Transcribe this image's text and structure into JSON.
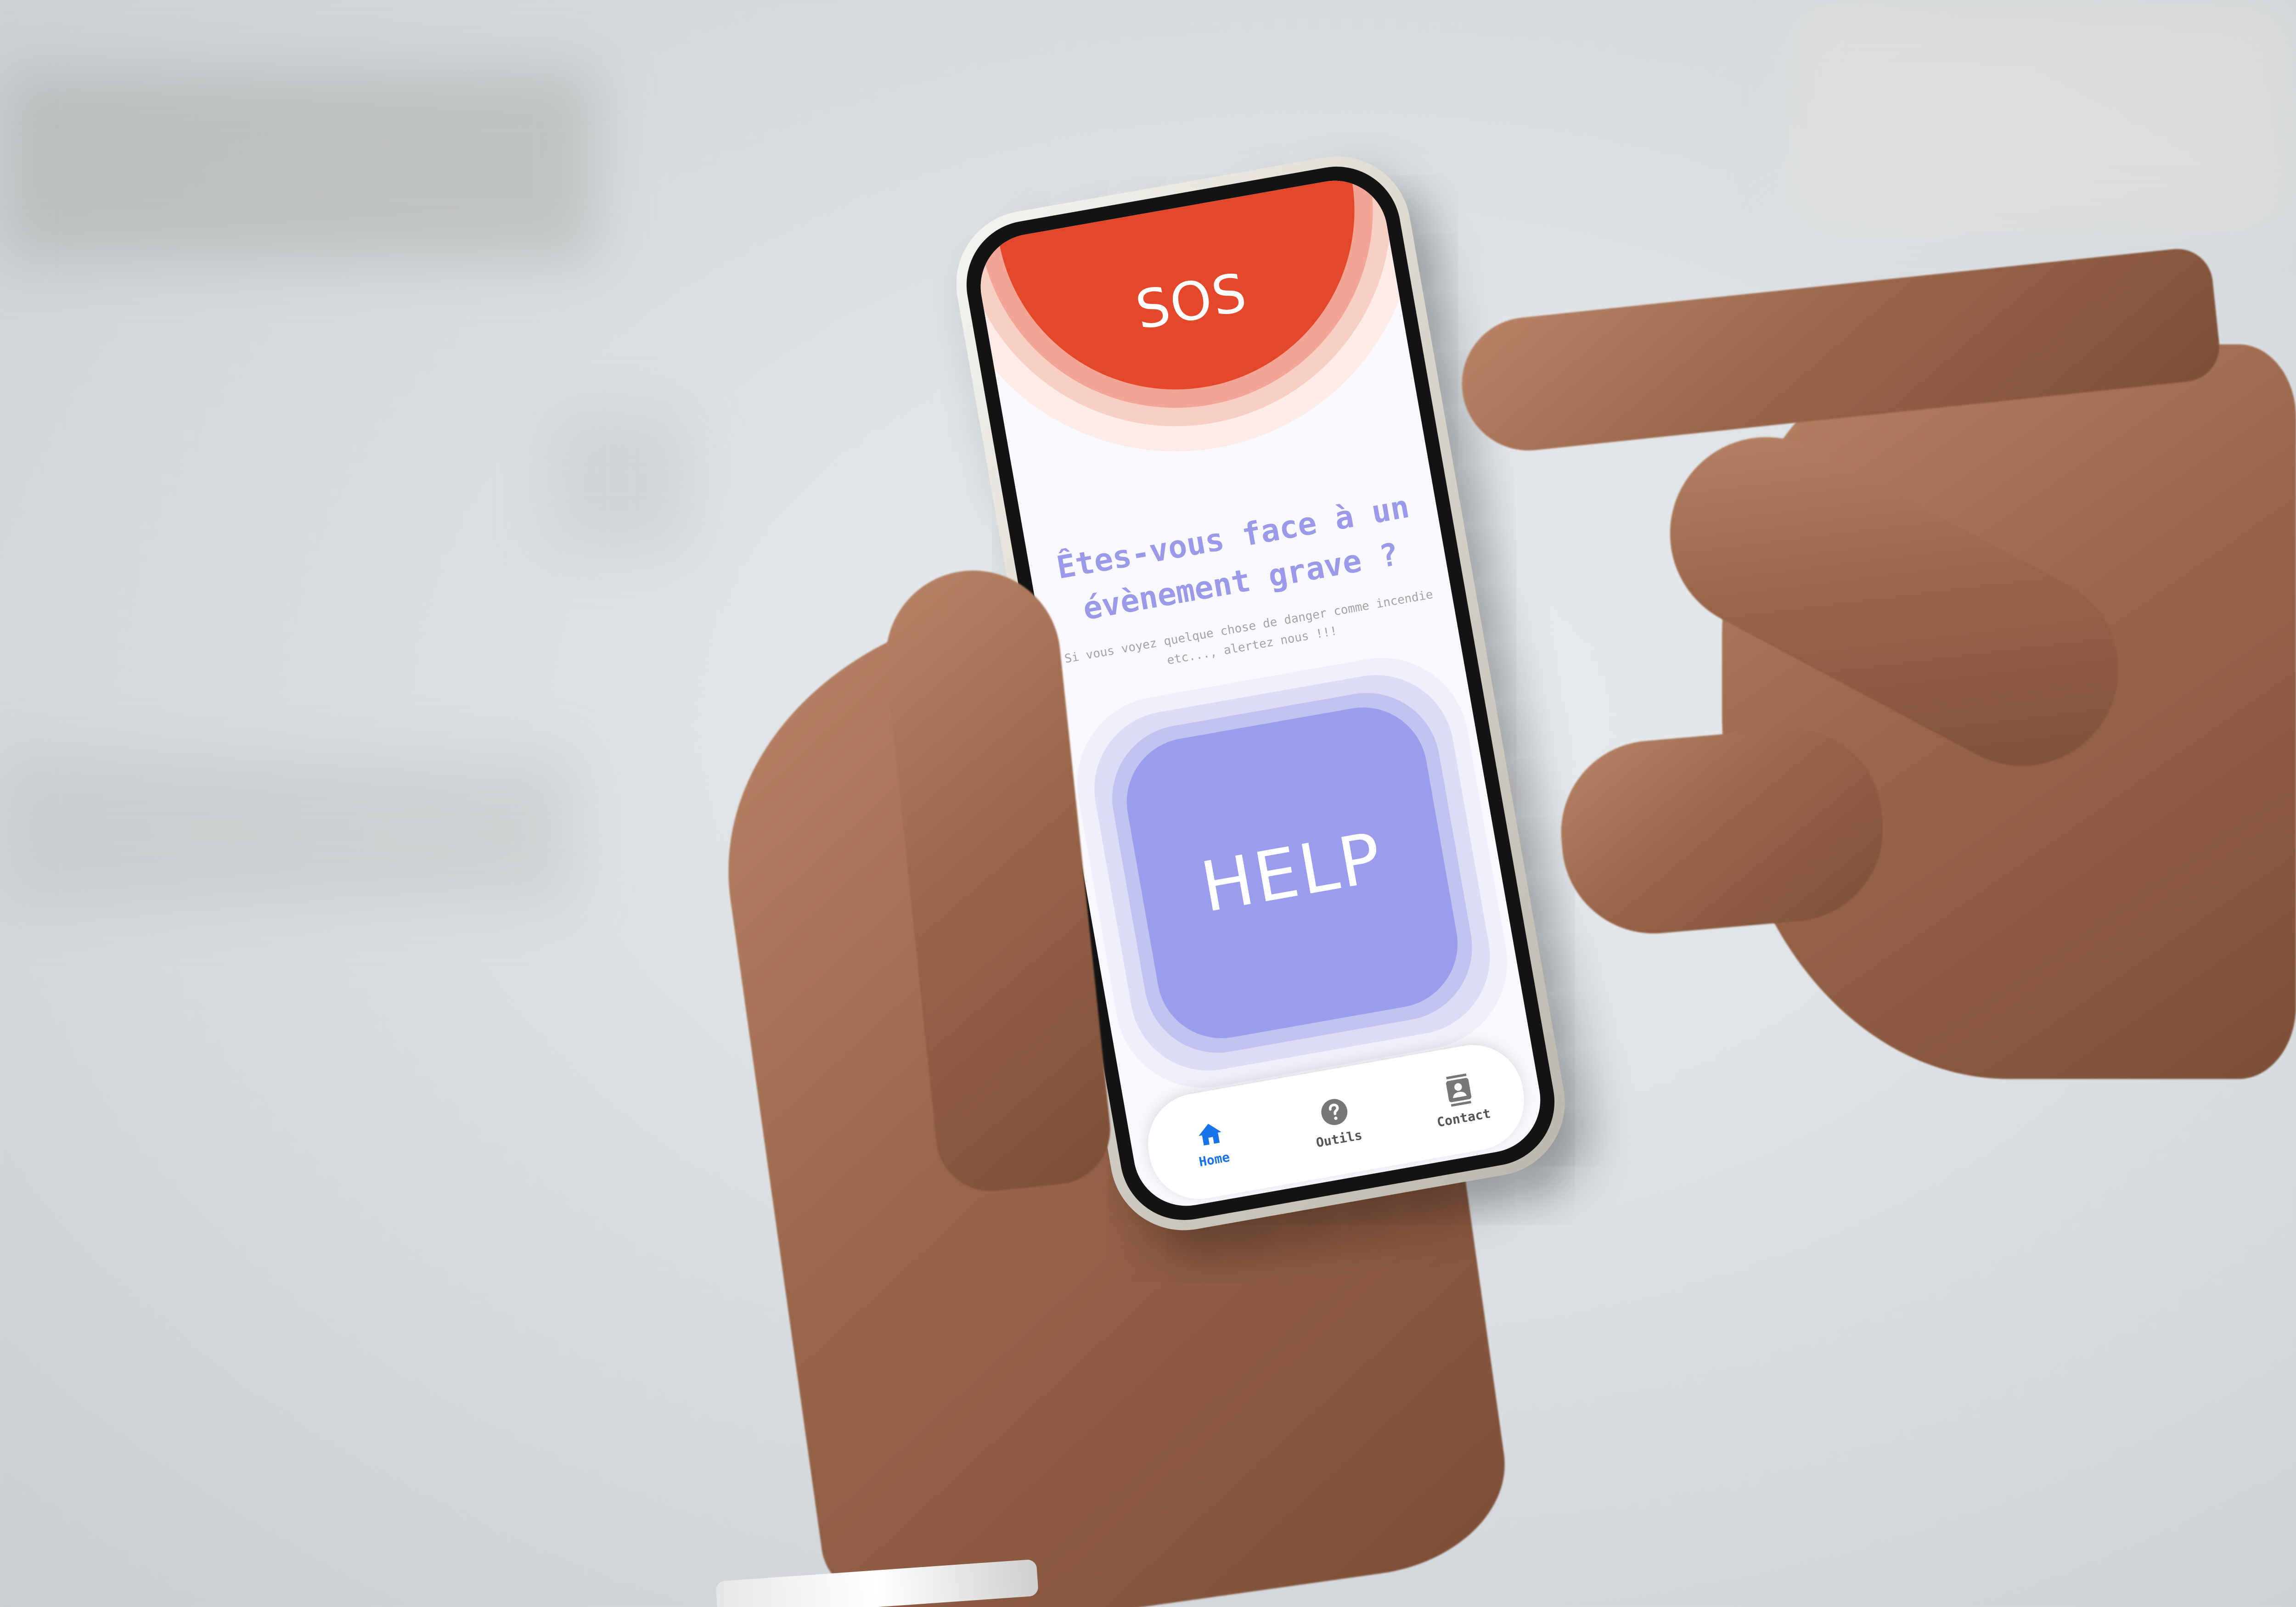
{
  "app": {
    "sos_label": "SOS",
    "headline": "Êtes-vous face à un évènement grave ?",
    "subtext": "Si vous voyez quelque chose de danger comme incendie\netc..., alertez nous !!!",
    "help_label": "HELP"
  },
  "nav": {
    "items": [
      {
        "label": "Home",
        "icon": "home-icon",
        "active": true
      },
      {
        "label": "Outils",
        "icon": "help-circle-icon",
        "active": false
      },
      {
        "label": "Contact",
        "icon": "contact-book-icon",
        "active": false
      }
    ]
  },
  "colors": {
    "sos_red": "#e5472a",
    "help_purple": "#9a9cec",
    "headline_purple": "#9b9ae8",
    "active_blue": "#1a73e8"
  }
}
